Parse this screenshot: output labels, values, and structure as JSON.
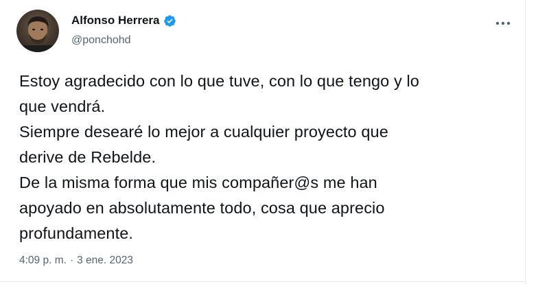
{
  "author": {
    "display_name": "Alfonso Herrera",
    "handle": "@ponchohd",
    "verified": true,
    "avatar_icon": "avatar-photo"
  },
  "more_options_icon": "more-horizontal-icon",
  "tweet": {
    "lines": [
      "Estoy agradecido con lo que tuve, con lo que tengo y lo",
      "que vendrá.",
      "Siempre desearé lo mejor a cualquier proyecto que",
      "derive de Rebelde.",
      "De la misma forma que mis compañer@s me han",
      "apoyado en absolutamente todo, cosa que aprecio",
      "profundamente."
    ]
  },
  "meta": {
    "time": "4:09 p. m.",
    "separator": "·",
    "date": "3 ene. 2023"
  },
  "colors": {
    "verified_badge": "#1d9bf0",
    "text_primary": "#0f1419",
    "text_secondary": "#536471"
  }
}
